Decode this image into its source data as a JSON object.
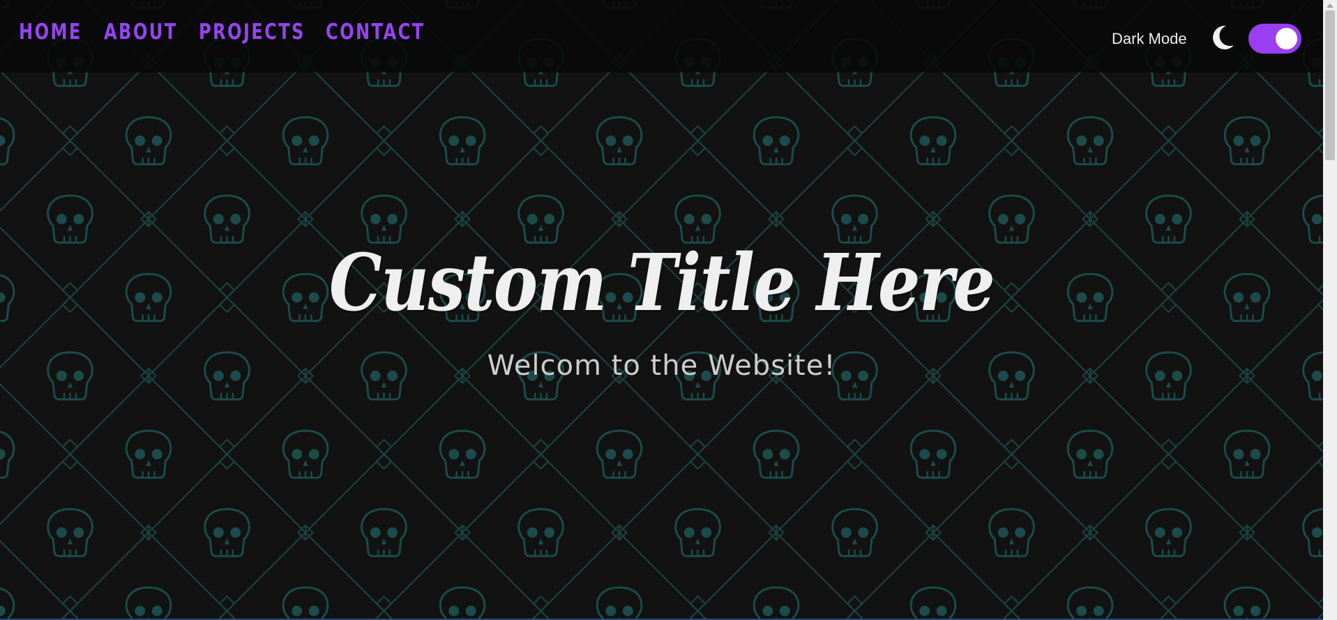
{
  "nav": {
    "items": [
      {
        "label": "HOME"
      },
      {
        "label": "ABOUT"
      },
      {
        "label": "PROJECTS"
      },
      {
        "label": "CONTACT"
      }
    ]
  },
  "theme": {
    "dark_mode_label": "Dark Mode",
    "toggle_on": true,
    "toggle_icon": "moon-icon"
  },
  "hero": {
    "title": "Custom Title Here",
    "subtitle": "Welcom to the Website!"
  },
  "colors": {
    "accent": "#9544f0",
    "background": "#111111",
    "pattern": "#1b4b4a",
    "title": "#efefef"
  }
}
